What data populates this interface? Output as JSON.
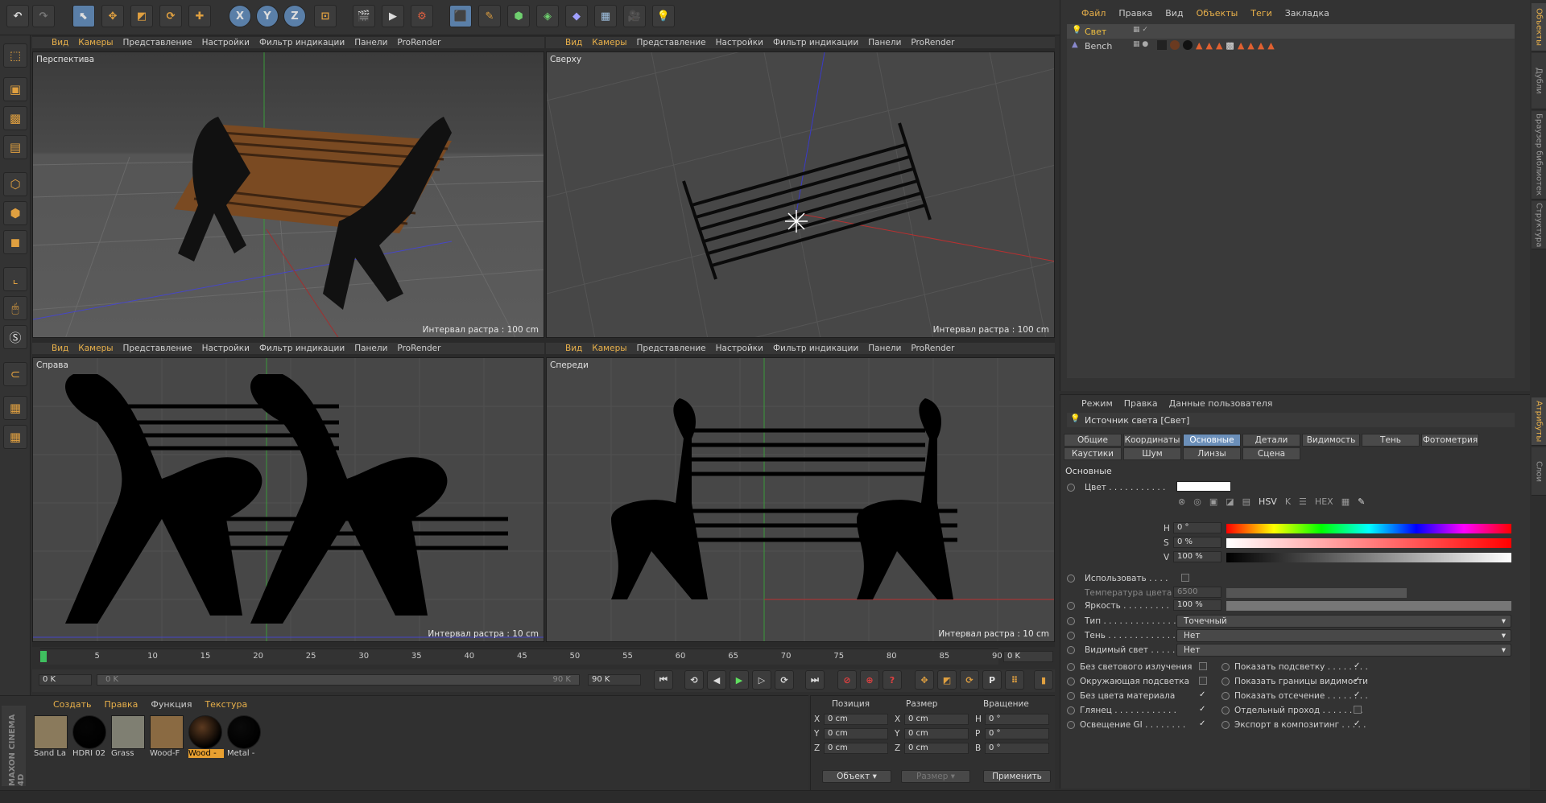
{
  "toolbar": {
    "undo_icon": "undo-icon",
    "axis_x": "X",
    "axis_y": "Y",
    "axis_z": "Z"
  },
  "viewport_menu": [
    "Вид",
    "Камеры",
    "Представление",
    "Настройки",
    "Фильтр индикации",
    "Панели",
    "ProRender"
  ],
  "viewports": {
    "perspective": {
      "label": "Перспектива",
      "interval": "Интервал растра : 100 cm"
    },
    "top": {
      "label": "Сверху",
      "interval": "Интервал растра : 100 cm"
    },
    "right": {
      "label": "Справа",
      "interval": "Интервал растра : 10 cm"
    },
    "front": {
      "label": "Спереди",
      "interval": "Интервал растра : 10 cm"
    }
  },
  "timeline": {
    "ticks": [
      "0",
      "5",
      "10",
      "15",
      "20",
      "25",
      "30",
      "35",
      "40",
      "45",
      "50",
      "55",
      "60",
      "65",
      "70",
      "75",
      "80",
      "85",
      "90"
    ],
    "frame_box": "0 K",
    "start": "0 K",
    "range_start": "0 K",
    "range_end": "90 K",
    "end": "90 K"
  },
  "materials": {
    "menu": [
      "Создать",
      "Правка",
      "Функция",
      "Текстура"
    ],
    "items": [
      {
        "label": "Sand La",
        "color": "#8a7a5c"
      },
      {
        "label": "HDRI 02",
        "color": "#050505"
      },
      {
        "label": "Grass",
        "color": "#7f7f72"
      },
      {
        "label": "Wood-F",
        "color": "#8a6a42"
      },
      {
        "label": "Wood -",
        "color": "#5c3a20"
      },
      {
        "label": "Metal -",
        "color": "#0a0a0a"
      }
    ],
    "brand": "MAXON CINEMA 4D"
  },
  "coords": {
    "headers": [
      "Позиция",
      "Размер",
      "Вращение"
    ],
    "rows": [
      {
        "a": "X",
        "pos": "0 cm",
        "b": "X",
        "size": "0 cm",
        "c": "H",
        "rot": "0 °"
      },
      {
        "a": "Y",
        "pos": "0 cm",
        "b": "Y",
        "size": "0 cm",
        "c": "P",
        "rot": "0 °"
      },
      {
        "a": "Z",
        "pos": "0 cm",
        "b": "Z",
        "size": "0 cm",
        "c": "B",
        "rot": "0 °"
      }
    ],
    "object_select": "Объект",
    "size_select": "Размер",
    "apply": "Применить"
  },
  "object_manager": {
    "menu": [
      "Файл",
      "Правка",
      "Вид",
      "Объекты",
      "Теги",
      "Закладка"
    ],
    "objects": [
      {
        "name": "Свет"
      },
      {
        "name": "Bench"
      }
    ]
  },
  "side_tabs_top": [
    "Объекты",
    "Дубли",
    "Браузер библиотек",
    "Структура"
  ],
  "side_tabs_bottom": [
    "Атрибуты",
    "Слои"
  ],
  "attributes": {
    "menu": [
      "Режим",
      "Правка",
      "Данные пользователя"
    ],
    "title": "Источник света [Свет]",
    "tabs_row1": [
      "Общие",
      "Координаты",
      "Основные",
      "Детали",
      "Видимость",
      "Тень",
      "Фотометрия"
    ],
    "tabs_row2": [
      "Каустики",
      "Шум",
      "Линзы",
      "Сцена"
    ],
    "selected_tab": "Основные",
    "section": "Основные",
    "color_label": "Цвет . . . . . . . . . . .",
    "h_label": "H",
    "h_value": "0 °",
    "s_label": "S",
    "s_value": "0 %",
    "v_label": "V",
    "v_value": "100 %",
    "use_temp": "Использовать . . . .",
    "temp_label": "Температура цвета",
    "temp_value": "6500",
    "brightness_label": "Яркость . . . . . . . . .",
    "brightness_value": "100 %",
    "type_label": "Тип . . . . . . . . . . . . . .",
    "type_value": "Точечный",
    "shadow_label": "Тень . . . . . . . . . . . . .",
    "shadow_value": "Нет",
    "visible_label": "Видимый свет . . . . .",
    "visible_value": "Нет",
    "checks_left": [
      {
        "label": "Без светового излучения",
        "checked": false
      },
      {
        "label": "Окружающая подсветка",
        "checked": false
      },
      {
        "label": "Без цвета материала",
        "checked": true
      },
      {
        "label": "Глянец . . . . . . . . . . . .",
        "checked": true
      },
      {
        "label": "Освещение GI . . . . . . . .",
        "checked": true
      }
    ],
    "checks_right": [
      {
        "label": "Показать подсветку . . . . . . . .",
        "checked": true
      },
      {
        "label": "Показать границы видимости",
        "checked": true
      },
      {
        "label": "Показать отсечение . . . . . . . .",
        "checked": true
      },
      {
        "label": "Отдельный проход . . . . . . . .",
        "checked": false
      },
      {
        "label": "Экспорт в композитинг . . . . .",
        "checked": true
      }
    ]
  }
}
